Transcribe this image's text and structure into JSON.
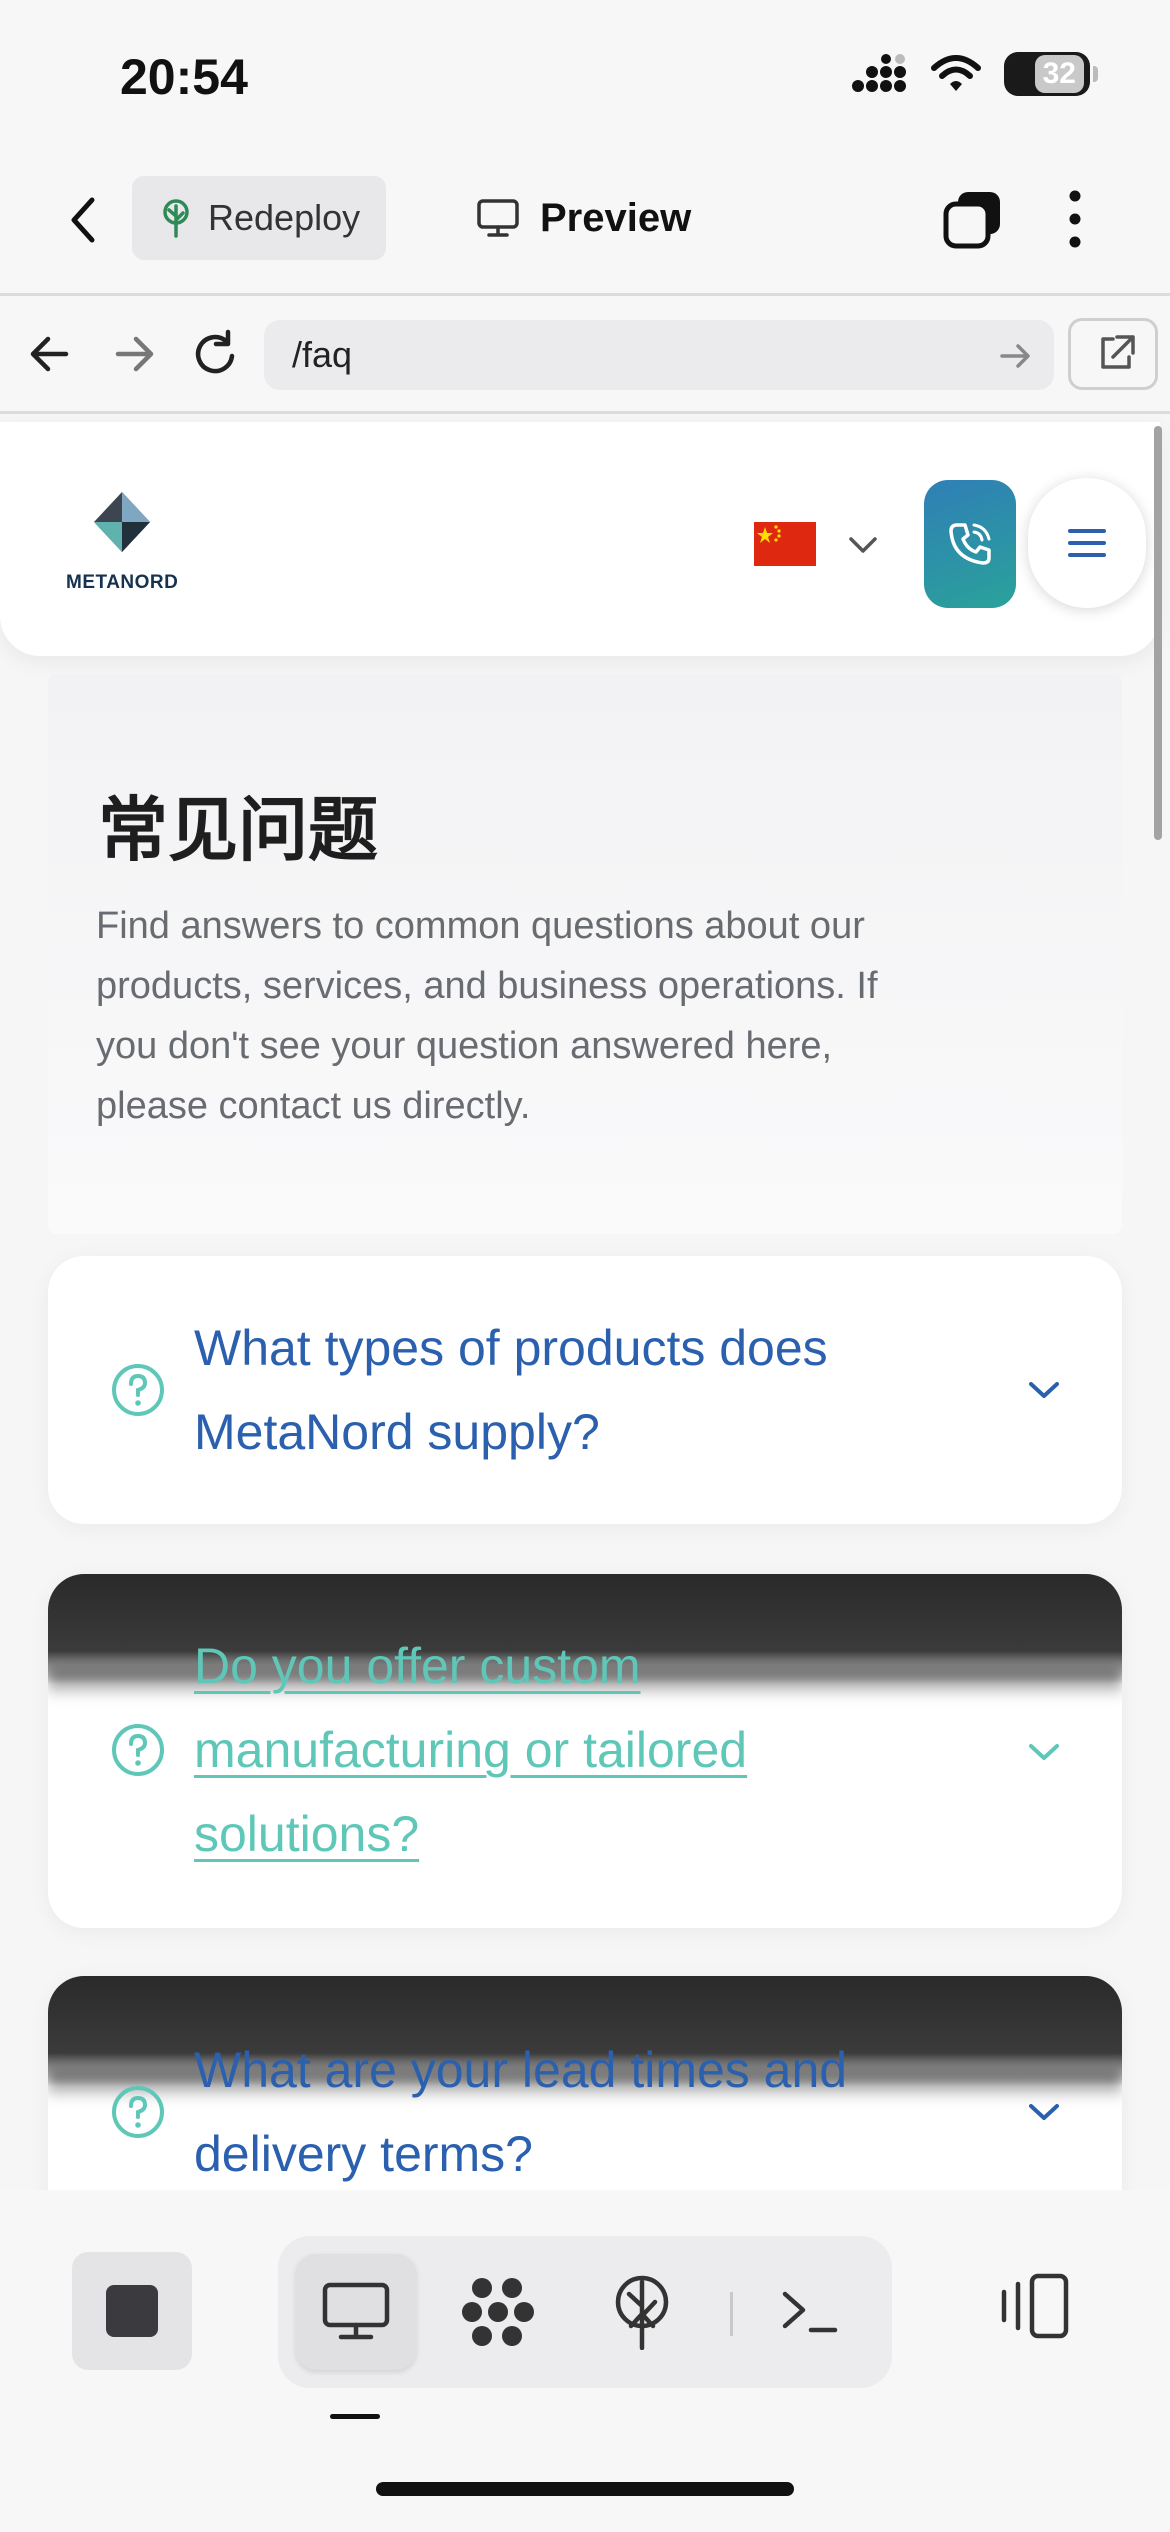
{
  "status_bar": {
    "time": "20:54",
    "battery": "32"
  },
  "app_toolbar": {
    "redeploy_label": "Redeploy",
    "preview_label": "Preview"
  },
  "browser": {
    "url": "/faq"
  },
  "site": {
    "logo_text": "METANORD",
    "language": "zh-CN"
  },
  "page": {
    "title": "常见问题",
    "intro": "Find answers to common questions about our products, services, and business operations. If you don't see your question answered here, please contact us directly."
  },
  "faq": {
    "items": [
      {
        "question": "What types of products does MetaNord supply?"
      },
      {
        "question": "Do you offer custom manufacturing or tailored solutions?"
      },
      {
        "question": "What are your lead times and delivery terms?"
      }
    ]
  },
  "colors": {
    "accent_blue": "#2b60ae",
    "accent_teal": "#5ec7b8",
    "call_gradient_start": "#2f7fb6",
    "call_gradient_end": "#2aa29a"
  },
  "icons": {
    "back": "chevron-left-icon",
    "redeploy": "tree-icon",
    "preview": "monitor-icon",
    "tabs": "tabs-icon",
    "more": "more-vertical-icon",
    "nav_back": "arrow-left-icon",
    "nav_forward": "arrow-right-icon",
    "reload": "reload-icon",
    "external": "external-link-icon",
    "call": "phone-icon",
    "menu": "hamburger-icon",
    "question": "question-circle-icon"
  }
}
